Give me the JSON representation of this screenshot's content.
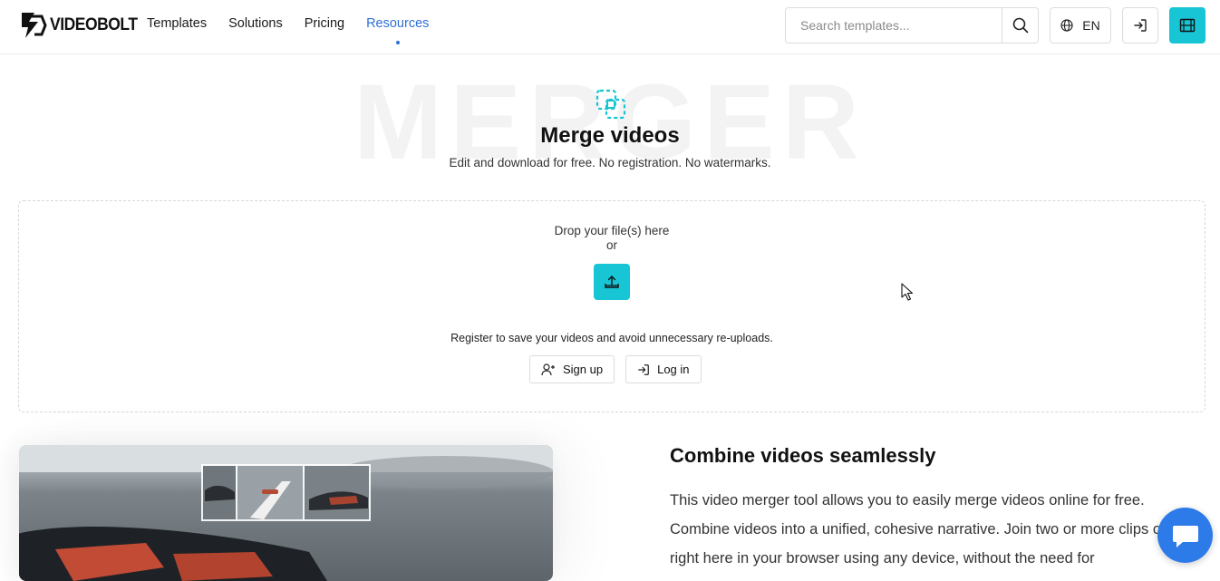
{
  "brand": {
    "name": "VIDEOBOLT",
    "accent": "#17c5d4",
    "link_active": "#2f6fd6",
    "chat_blue": "#2c7be8"
  },
  "nav": {
    "items": [
      {
        "label": "Templates"
      },
      {
        "label": "Solutions"
      },
      {
        "label": "Pricing"
      },
      {
        "label": "Resources",
        "active": true
      }
    ]
  },
  "search": {
    "placeholder": "Search templates...",
    "value": "",
    "icon": "search-icon"
  },
  "language": {
    "label": "EN",
    "icon": "globe-icon"
  },
  "header_icons": {
    "login": "login-icon",
    "projects": "film-icon"
  },
  "hero": {
    "watermark": "MERGER",
    "icon": "merge-squares-icon",
    "title": "Merge videos",
    "subtitle": "Edit and download for free. No registration. No watermarks."
  },
  "dropzone": {
    "line1": "Drop your file(s) here",
    "line2": "or",
    "upload_icon": "upload-icon",
    "register_text": "Register to save your videos and avoid unnecessary re-uploads.",
    "signup_label": "Sign up",
    "login_label": "Log in"
  },
  "feature": {
    "title": "Combine videos seamlessly",
    "body": "This video merger tool allows you to easily merge videos online for free. Combine videos into a unified, cohesive narrative. Join two or more clips online right here in your browser using any device, without the need for"
  },
  "chat": {
    "icon": "chat-bubble-icon"
  }
}
